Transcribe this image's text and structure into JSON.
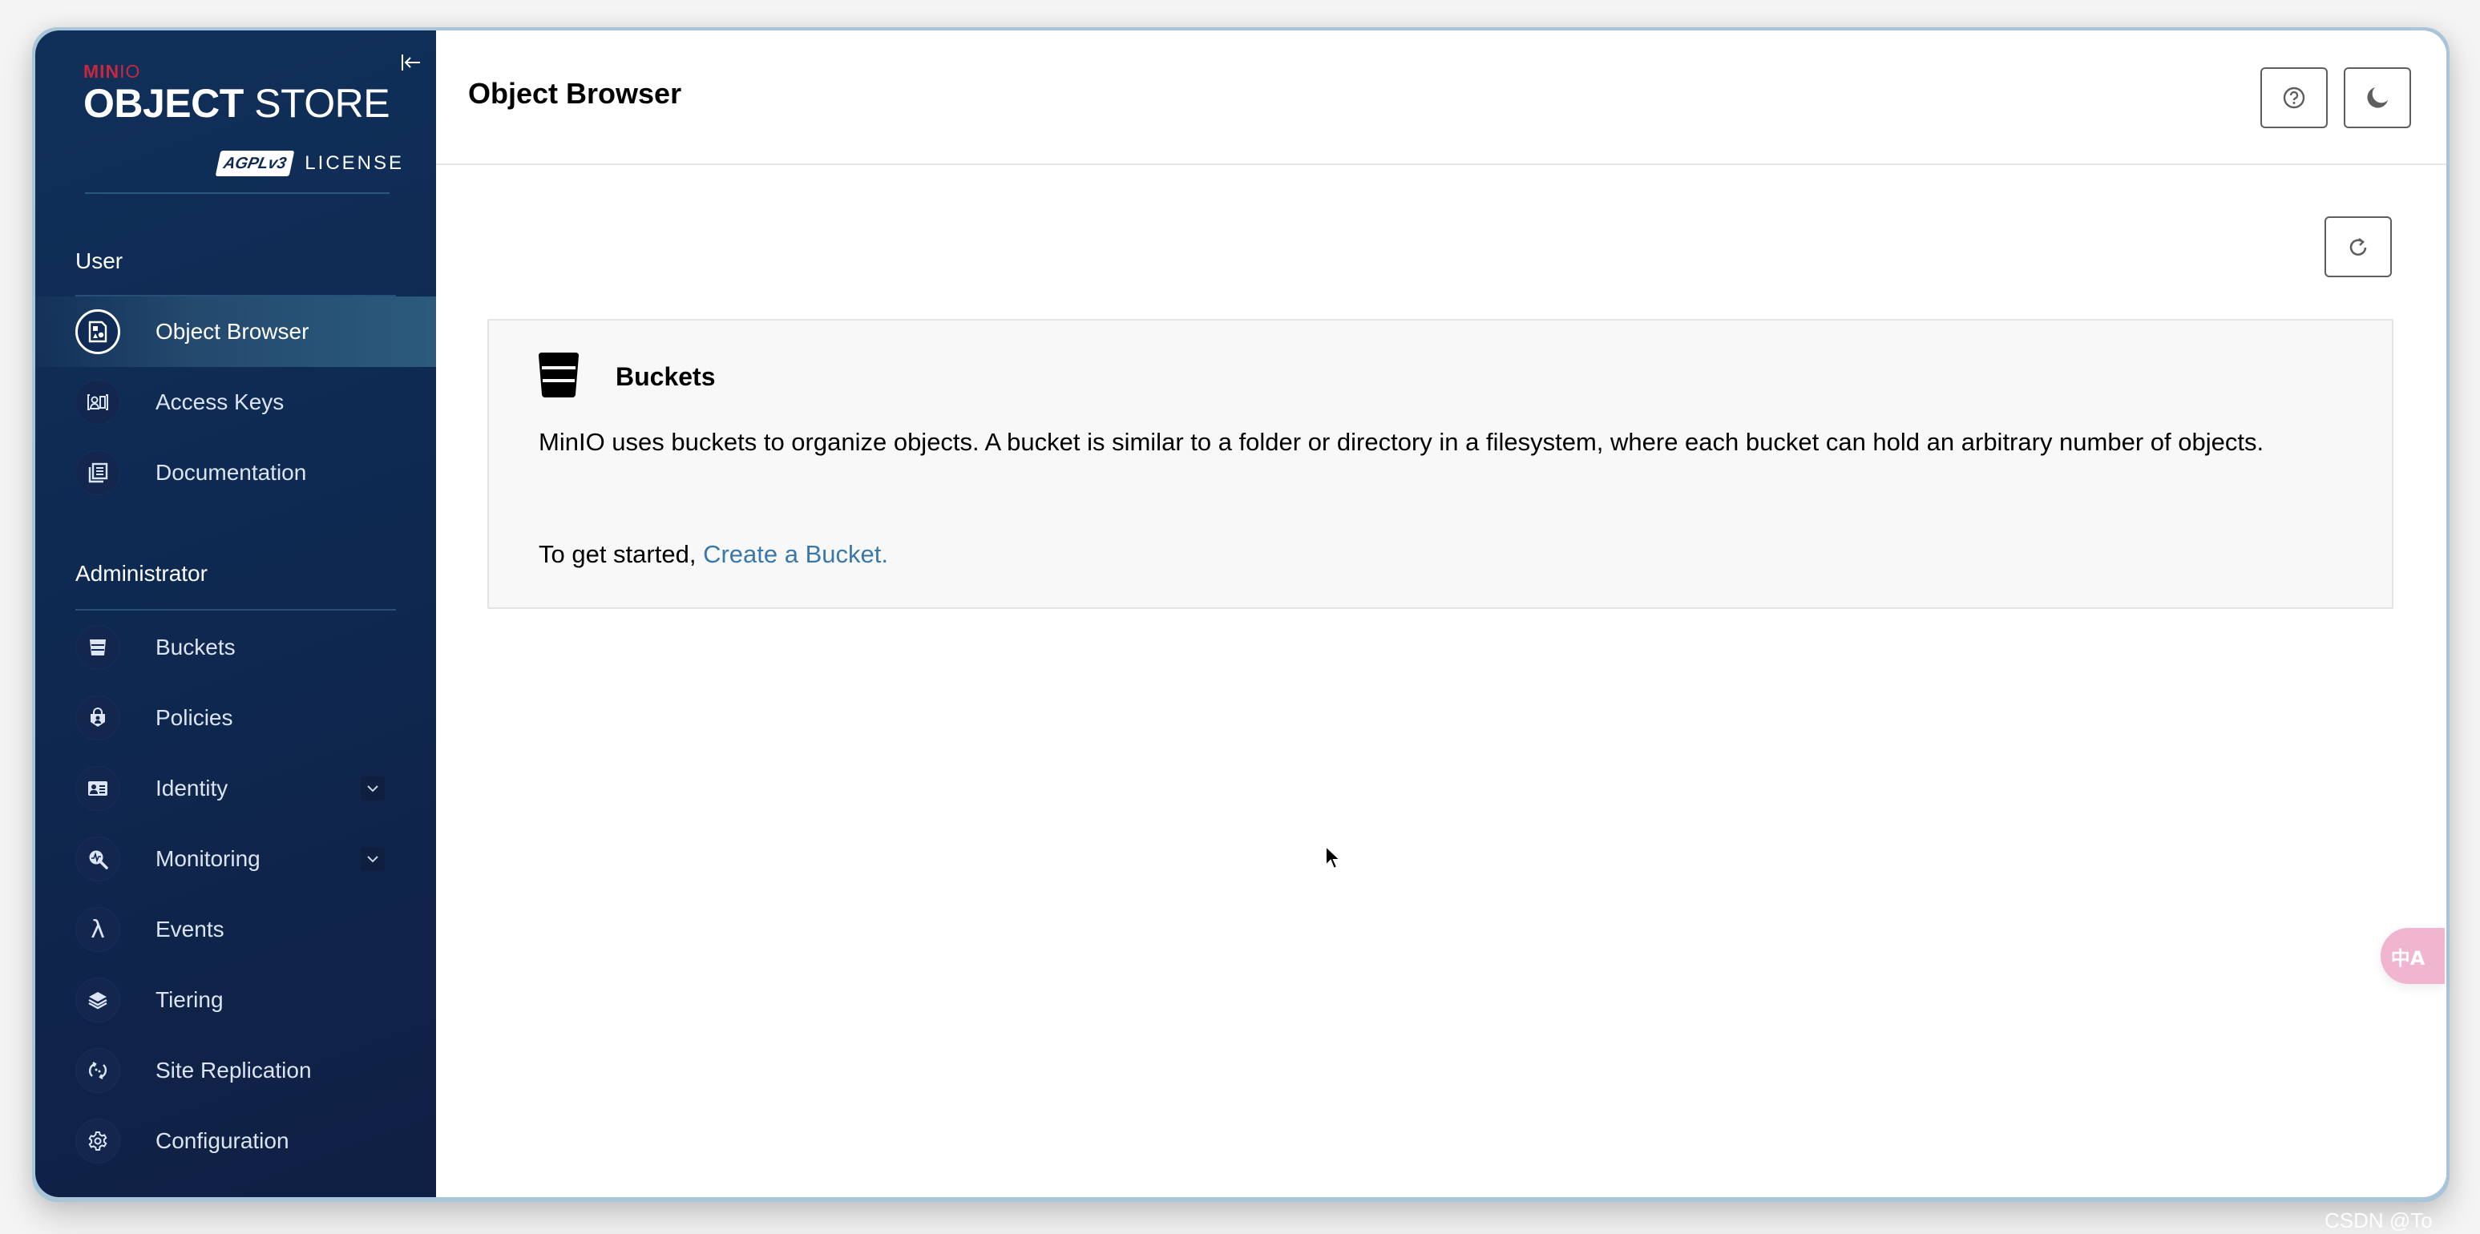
{
  "sidebar": {
    "logo": {
      "brand_a": "MIN",
      "brand_b": "IO",
      "product_bold": "OBJECT",
      "product_light": "STORE",
      "badge": "AGPLv3",
      "license": "LICENSE"
    },
    "collapse_label": "Collapse sidebar",
    "sections": [
      {
        "label": "User",
        "items": [
          {
            "label": "Object Browser",
            "icon": "object-browser-icon",
            "active": true
          },
          {
            "label": "Access Keys",
            "icon": "access-keys-icon"
          },
          {
            "label": "Documentation",
            "icon": "documentation-icon"
          }
        ]
      },
      {
        "label": "Administrator",
        "items": [
          {
            "label": "Buckets",
            "icon": "bucket-icon"
          },
          {
            "label": "Policies",
            "icon": "policies-icon"
          },
          {
            "label": "Identity",
            "icon": "identity-icon",
            "expandable": true
          },
          {
            "label": "Monitoring",
            "icon": "monitoring-icon",
            "expandable": true
          },
          {
            "label": "Events",
            "icon": "lambda-icon"
          },
          {
            "label": "Tiering",
            "icon": "tiering-icon"
          },
          {
            "label": "Site Replication",
            "icon": "site-replication-icon"
          },
          {
            "label": "Configuration",
            "icon": "gear-icon"
          }
        ]
      }
    ]
  },
  "header": {
    "title": "Object Browser",
    "help_icon": "help-icon",
    "theme_icon": "moon-icon"
  },
  "toolbar": {
    "refresh_icon": "refresh-icon"
  },
  "empty_state": {
    "title": "Buckets",
    "description": "MinIO uses buckets to organize objects. A bucket is similar to a folder or directory in a filesystem, where each bucket can hold an arbitrary number of objects.",
    "cta_prefix": "To get started, ",
    "cta_link": "Create a Bucket."
  },
  "floating": {
    "translate_label": "中A"
  },
  "watermark": "CSDN @To",
  "colors": {
    "sidebar_bg": "#0e2a52",
    "link": "#3a78a8",
    "brand_red": "#c8283f",
    "card_bg": "#f8f8f8"
  }
}
